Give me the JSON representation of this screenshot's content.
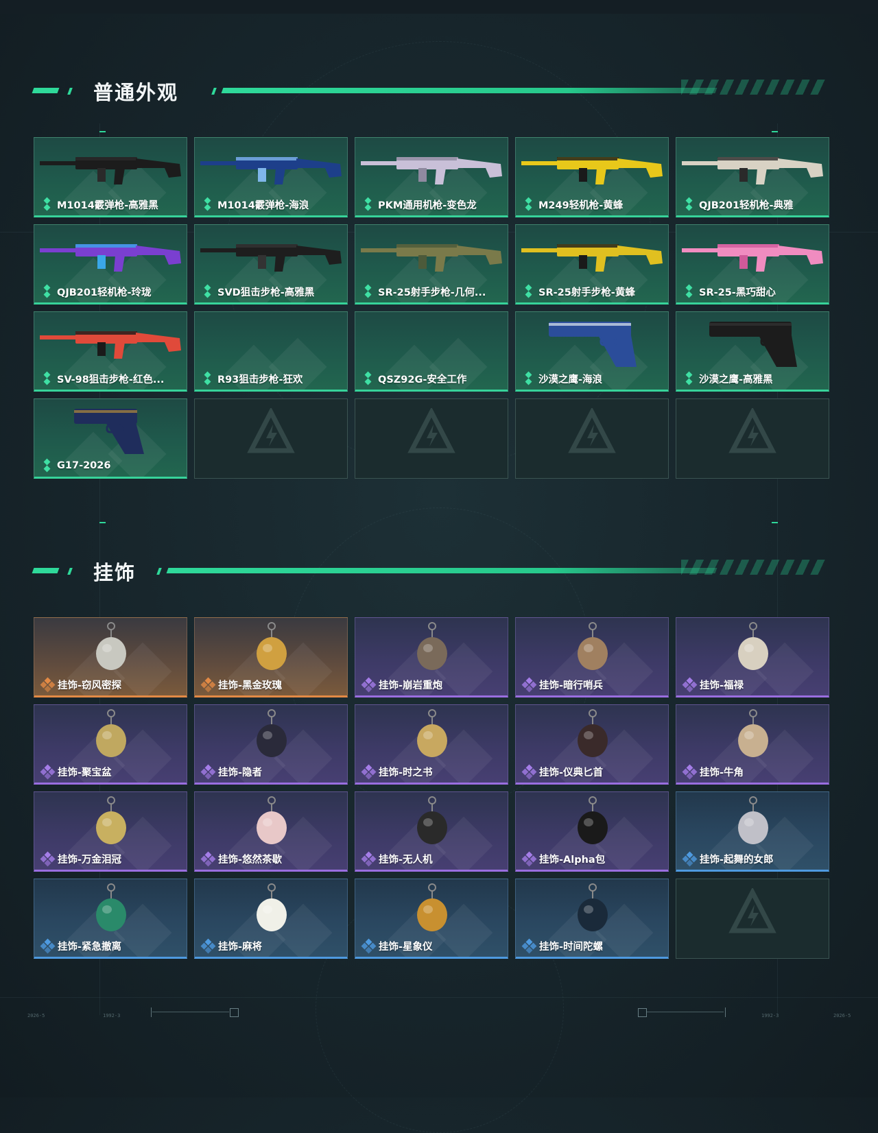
{
  "sections": {
    "skins": {
      "title": "普通外观",
      "items": [
        {
          "label": "M1014霰弹枪-高雅黑",
          "state": "item"
        },
        {
          "label": "M1014霰弹枪-海浪",
          "state": "item"
        },
        {
          "label": "PKM通用机枪-变色龙",
          "state": "item"
        },
        {
          "label": "M249轻机枪-黄蜂",
          "state": "item"
        },
        {
          "label": "QJB201轻机枪-典雅",
          "state": "item"
        },
        {
          "label": "QJB201轻机枪-玲珑",
          "state": "item"
        },
        {
          "label": "SVD狙击步枪-高雅黑",
          "state": "item"
        },
        {
          "label": "SR-25射手步枪-几何...",
          "state": "item"
        },
        {
          "label": "SR-25射手步枪-黄蜂",
          "state": "item"
        },
        {
          "label": "SR-25-黑巧甜心",
          "state": "item"
        },
        {
          "label": "SV-98狙击步枪-红色...",
          "state": "item"
        },
        {
          "label": "R93狙击步枪-狂欢",
          "state": "item"
        },
        {
          "label": "QSZ92G-安全工作",
          "state": "item"
        },
        {
          "label": "沙漠之鹰-海浪",
          "state": "item"
        },
        {
          "label": "沙漠之鹰-高雅黑",
          "state": "item"
        },
        {
          "label": "G17-2026",
          "state": "item"
        },
        {
          "label": "",
          "state": "empty"
        },
        {
          "label": "",
          "state": "empty"
        },
        {
          "label": "",
          "state": "empty"
        },
        {
          "label": "",
          "state": "empty"
        }
      ]
    },
    "charms": {
      "title": "挂饰",
      "items": [
        {
          "label": "挂饰-窃风密探",
          "rarity": "orange"
        },
        {
          "label": "挂饰-黑金玫瑰",
          "rarity": "orange"
        },
        {
          "label": "挂饰-崩岩重炮",
          "rarity": "purple"
        },
        {
          "label": "挂饰-暗行哨兵",
          "rarity": "purple"
        },
        {
          "label": "挂饰-福禄",
          "rarity": "purple"
        },
        {
          "label": "挂饰-聚宝盆",
          "rarity": "purple"
        },
        {
          "label": "挂饰-隐者",
          "rarity": "purple"
        },
        {
          "label": "挂饰-时之书",
          "rarity": "purple"
        },
        {
          "label": "挂饰-仪典匕首",
          "rarity": "purple"
        },
        {
          "label": "挂饰-牛角",
          "rarity": "purple"
        },
        {
          "label": "挂饰-万金泪冠",
          "rarity": "purple"
        },
        {
          "label": "挂饰-悠然茶歇",
          "rarity": "purple"
        },
        {
          "label": "挂饰-无人机",
          "rarity": "purple"
        },
        {
          "label": "挂饰-Alpha包",
          "rarity": "purple"
        },
        {
          "label": "挂饰-起舞的女郎",
          "rarity": "blue"
        },
        {
          "label": "挂饰-紧急撤离",
          "rarity": "blue"
        },
        {
          "label": "挂饰-麻将",
          "rarity": "blue"
        },
        {
          "label": "挂饰-星象仪",
          "rarity": "blue"
        },
        {
          "label": "挂饰-时间陀螺",
          "rarity": "blue"
        },
        {
          "label": "",
          "rarity": "empty"
        }
      ]
    }
  },
  "colors": {
    "accent_green": "#2fd99a",
    "rarity_orange": "#e38a45",
    "rarity_purple": "#9a6ee0",
    "rarity_blue": "#4e9ae0"
  },
  "icons": {
    "rarity_green": "double-diamond-icon",
    "rarity_charm": "quad-diamond-icon",
    "empty_slot": "logo-watermark-icon"
  },
  "footer": {
    "tiny_left_1": "2026-5",
    "tiny_left_2": "1992-3",
    "tiny_right_1": "1992-3",
    "tiny_right_2": "2026-5"
  }
}
